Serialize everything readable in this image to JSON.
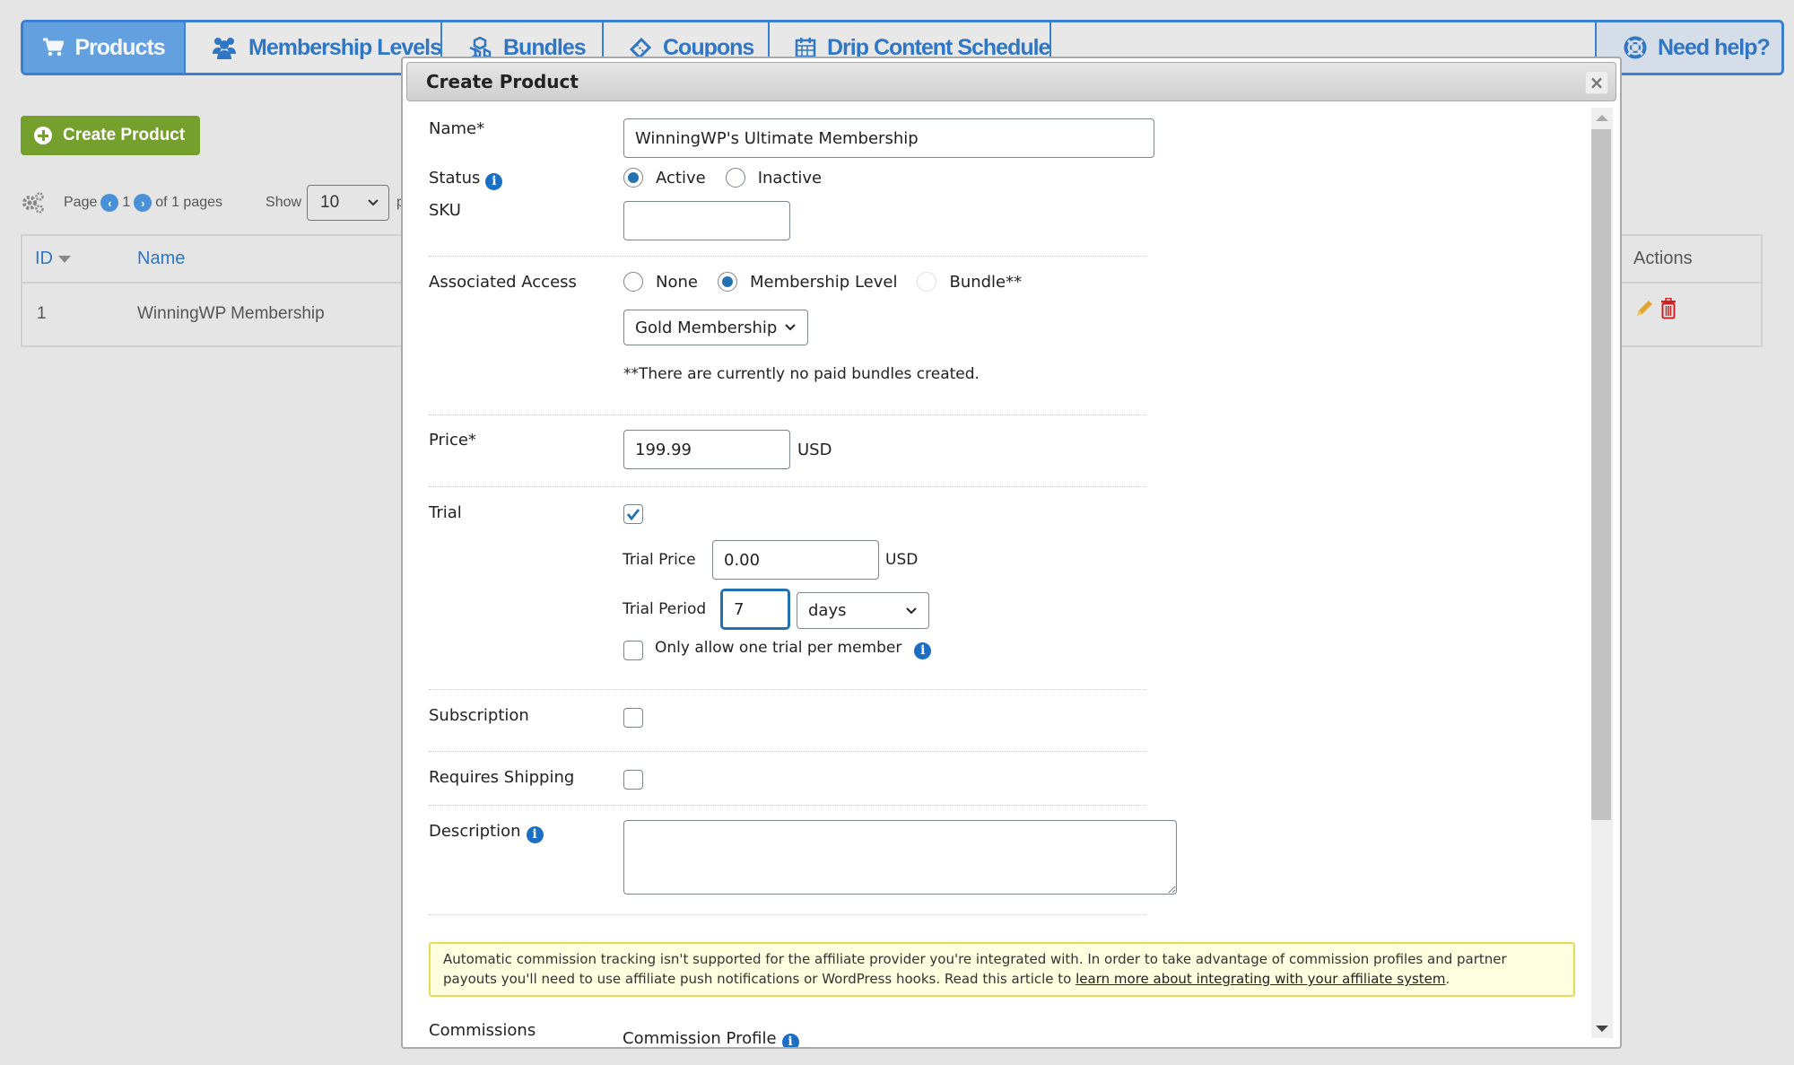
{
  "tabs": [
    {
      "label": "Products",
      "icon": "cart-icon",
      "active": true
    },
    {
      "label": "Membership Levels",
      "icon": "users-icon",
      "active": false
    },
    {
      "label": "Bundles",
      "icon": "cubes-icon",
      "active": false
    },
    {
      "label": "Coupons",
      "icon": "ticket-icon",
      "active": false
    },
    {
      "label": "Drip Content Schedule",
      "icon": "calendar-icon",
      "active": false
    }
  ],
  "help_tab": {
    "label": "Need help?",
    "icon": "lifebuoy-icon"
  },
  "page": {
    "create_button": "Create Product",
    "pager": {
      "page_label": "Page",
      "current": "1",
      "of_label": "of 1 pages",
      "show_label": "Show",
      "per_page": "10",
      "per_label": "per page"
    },
    "table": {
      "columns": {
        "id": "ID",
        "name": "Name",
        "actions": "Actions"
      },
      "rows": [
        {
          "id": "1",
          "name": "WinningWP Membership"
        }
      ]
    }
  },
  "modal": {
    "title": "Create Product",
    "close_label": "×",
    "name": {
      "label": "Name*",
      "value": "WinningWP's Ultimate Membership"
    },
    "status": {
      "label": "Status",
      "options": [
        "Active",
        "Inactive"
      ],
      "selected": "Active"
    },
    "sku": {
      "label": "SKU",
      "value": ""
    },
    "associated_access": {
      "label": "Associated Access",
      "options": [
        "None",
        "Membership Level",
        "Bundle**"
      ],
      "selected": "Membership Level",
      "membership_select": "Gold Membership",
      "note": "**There are currently no paid bundles created."
    },
    "price": {
      "label": "Price*",
      "value": "199.99",
      "currency": "USD"
    },
    "trial": {
      "label": "Trial",
      "checked": true,
      "price_label": "Trial Price",
      "price_value": "0.00",
      "currency": "USD",
      "period_label": "Trial Period",
      "period_value": "7",
      "period_unit": "days",
      "one_trial_label": "Only allow one trial per member",
      "one_trial_checked": false
    },
    "subscription": {
      "label": "Subscription",
      "checked": false
    },
    "requires_shipping": {
      "label": "Requires Shipping",
      "checked": false
    },
    "description": {
      "label": "Description",
      "value": ""
    },
    "notice": {
      "text": "Automatic commission tracking isn't supported for the affiliate provider you're integrated with. In order to take advantage of commission profiles and partner payouts you'll need to use affiliate push notifications or WordPress hooks. Read this article to ",
      "link": "learn more about integrating with your affiliate system",
      "suffix": "."
    },
    "commissions": {
      "label": "Commissions",
      "profile_label": "Commission Profile"
    }
  },
  "colors": {
    "accent": "#2f76c5",
    "active_tab": "#62a0e0",
    "create_button": "#76a02e",
    "notice_bg": "#ffffe0",
    "edit": "#e0a82e",
    "delete": "#cc2222"
  }
}
